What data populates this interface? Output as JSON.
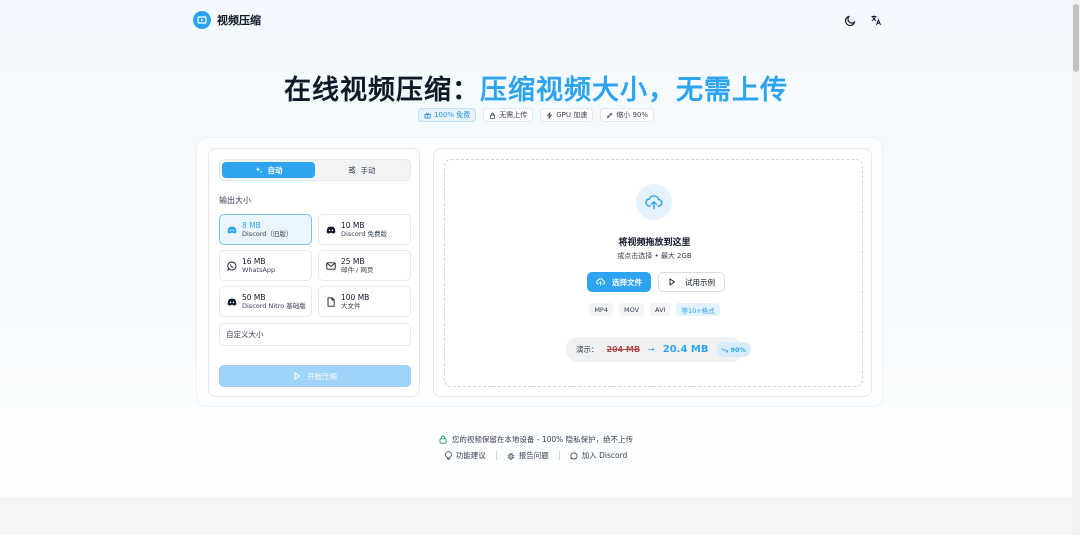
{
  "header": {
    "logo_text": "视频压缩",
    "icons": {
      "theme": "moon-icon",
      "language": "translate-icon"
    }
  },
  "hero": {
    "title_dark": "在线视频压缩：",
    "title_accent": "压缩视频大小，无需上传",
    "badges": [
      {
        "icon": "gift-icon",
        "label": "100% 免费",
        "active": true
      },
      {
        "icon": "lock-icon",
        "label": "无需上传",
        "active": false
      },
      {
        "icon": "bolt-icon",
        "label": "GPU 加速",
        "active": false
      },
      {
        "icon": "shrink-icon",
        "label": "缩小 90%",
        "active": false
      }
    ]
  },
  "settings": {
    "mode_auto": "自动",
    "mode_manual": "手动",
    "output_size_label": "输出大小",
    "presets": [
      {
        "size": "8 MB",
        "desc": "Discord（旧版）",
        "icon": "discord-icon",
        "selected": true
      },
      {
        "size": "10 MB",
        "desc": "Discord 免费版",
        "icon": "discord-icon",
        "selected": false
      },
      {
        "size": "16 MB",
        "desc": "WhatsApp",
        "icon": "whatsapp-icon",
        "selected": false
      },
      {
        "size": "25 MB",
        "desc": "邮件 / 网页",
        "icon": "mail-icon",
        "selected": false
      },
      {
        "size": "50 MB",
        "desc": "Discord Nitro 基础版",
        "icon": "discord-icon",
        "selected": false
      },
      {
        "size": "100 MB",
        "desc": "大文件",
        "icon": "file-icon",
        "selected": false
      }
    ],
    "custom_size_label": "自定义大小",
    "start_button": "开始压缩"
  },
  "dropzone": {
    "title": "将视频拖放到这里",
    "subtitle": "或点击选择 • 最大 2GB",
    "select_button": "选择文件",
    "try_button": "试用示例",
    "formats": [
      "MP4",
      "MOV",
      "AVI"
    ],
    "formats_more": "等10+格式",
    "demo": {
      "label": "演示：",
      "from": "204 MB",
      "to": "20.4 MB",
      "percent": "90%"
    }
  },
  "footer": {
    "privacy_text": "您的视频保留在本地设备 - 100% 隐私保护，绝不上传",
    "links": [
      {
        "icon": "lightbulb-icon",
        "label": "功能建议"
      },
      {
        "icon": "bug-icon",
        "label": "报告问题"
      },
      {
        "icon": "chat-icon",
        "label": "加入 Discord"
      }
    ]
  },
  "colors": {
    "accent": "#2ea4f0",
    "selected_bg": "#eaf6fe",
    "disabled_button": "#9fd3f7",
    "strike_red": "#b24d4d",
    "privacy_green": "#22a35a"
  }
}
